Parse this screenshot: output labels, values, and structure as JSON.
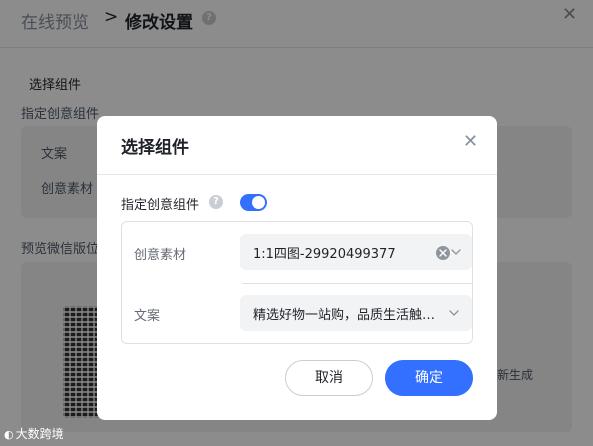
{
  "background": {
    "breadcrumb": {
      "root": "在线预览",
      "separator": ">",
      "current": "修改设置"
    },
    "section_title": "选择组件",
    "assign_label": "指定创意组件",
    "card_labels": [
      "文案",
      "创意素材"
    ],
    "preview_label": "预览微信版位",
    "regenerate_partial": "新生成",
    "watermark": "大数跨境"
  },
  "modal": {
    "title": "选择组件",
    "assign_toggle": {
      "label": "指定创意组件",
      "enabled": true
    },
    "fields": [
      {
        "label": "创意素材",
        "value": "1:1四图-29920499377"
      },
      {
        "label": "文案",
        "value": "精选好物一站购，品质生活触手可及"
      }
    ],
    "buttons": {
      "cancel": "取消",
      "confirm": "确定"
    }
  },
  "colors": {
    "primary": "#3370ff",
    "overlay": "rgba(0,0,0,0.45)"
  },
  "icons": [
    "help-icon",
    "close-icon",
    "clear-icon",
    "chevron-down-icon",
    "toggle-switch"
  ]
}
